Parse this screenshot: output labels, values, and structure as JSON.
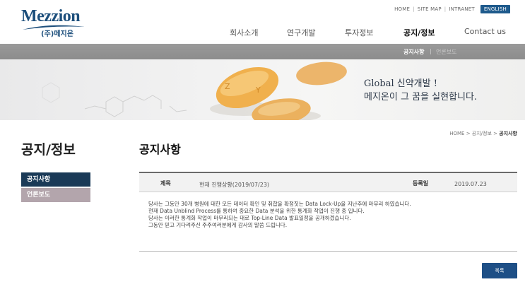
{
  "brand": {
    "name": "Mezzion",
    "korean_name": "(주)메지온"
  },
  "util_nav": {
    "home": "HOME",
    "sitemap": "SITE MAP",
    "intranet": "INTRANET",
    "english": "ENGLISH"
  },
  "gnb": [
    "회사소개",
    "연구개발",
    "투자정보",
    "공지/정보",
    "Contact us"
  ],
  "subnav": [
    "공지사항",
    "언론보도"
  ],
  "banner": {
    "line1": "Global 신약개발 !",
    "line2": "메지온이 그 꿈을 실현합니다."
  },
  "sidebar": {
    "title": "공지/정보",
    "items": [
      "공지사항",
      "언론보도"
    ]
  },
  "breadcrumb": {
    "home": "HOME",
    "parent": "공지/정보",
    "current": "공지사항"
  },
  "page_title": "공지사항",
  "post": {
    "subject_label": "제목",
    "subject": "현재 진행상황(2019/07/23)",
    "date_label": "등록일",
    "date": "2019.07.23",
    "body": [
      "당사는 그동안 30개 병원에 대한 모든 데이터 확인 및 취합을 확정짓는 Data Lock-Up을 지난주에 마무리 하였습니다.",
      "현재 Data Unblind Process를 통하여 중요한 Data 분석을 위한 통계화 작업이 진행 중 입니다.",
      "당사는 이러한 통계화 작업이 마무리되는 대로 Top-Line Data 발표일정을 공개하겠습니다.",
      "그동안 믿고 기다려주신 주주여러분에게 감사의 말씀 드립니다."
    ]
  },
  "list_button": "목록",
  "colors": {
    "brand_navy": "#1d4f7c",
    "lnb_active": "#1a3a57",
    "lnb_inactive": "#b3a5ac",
    "button": "#1e4f86"
  }
}
